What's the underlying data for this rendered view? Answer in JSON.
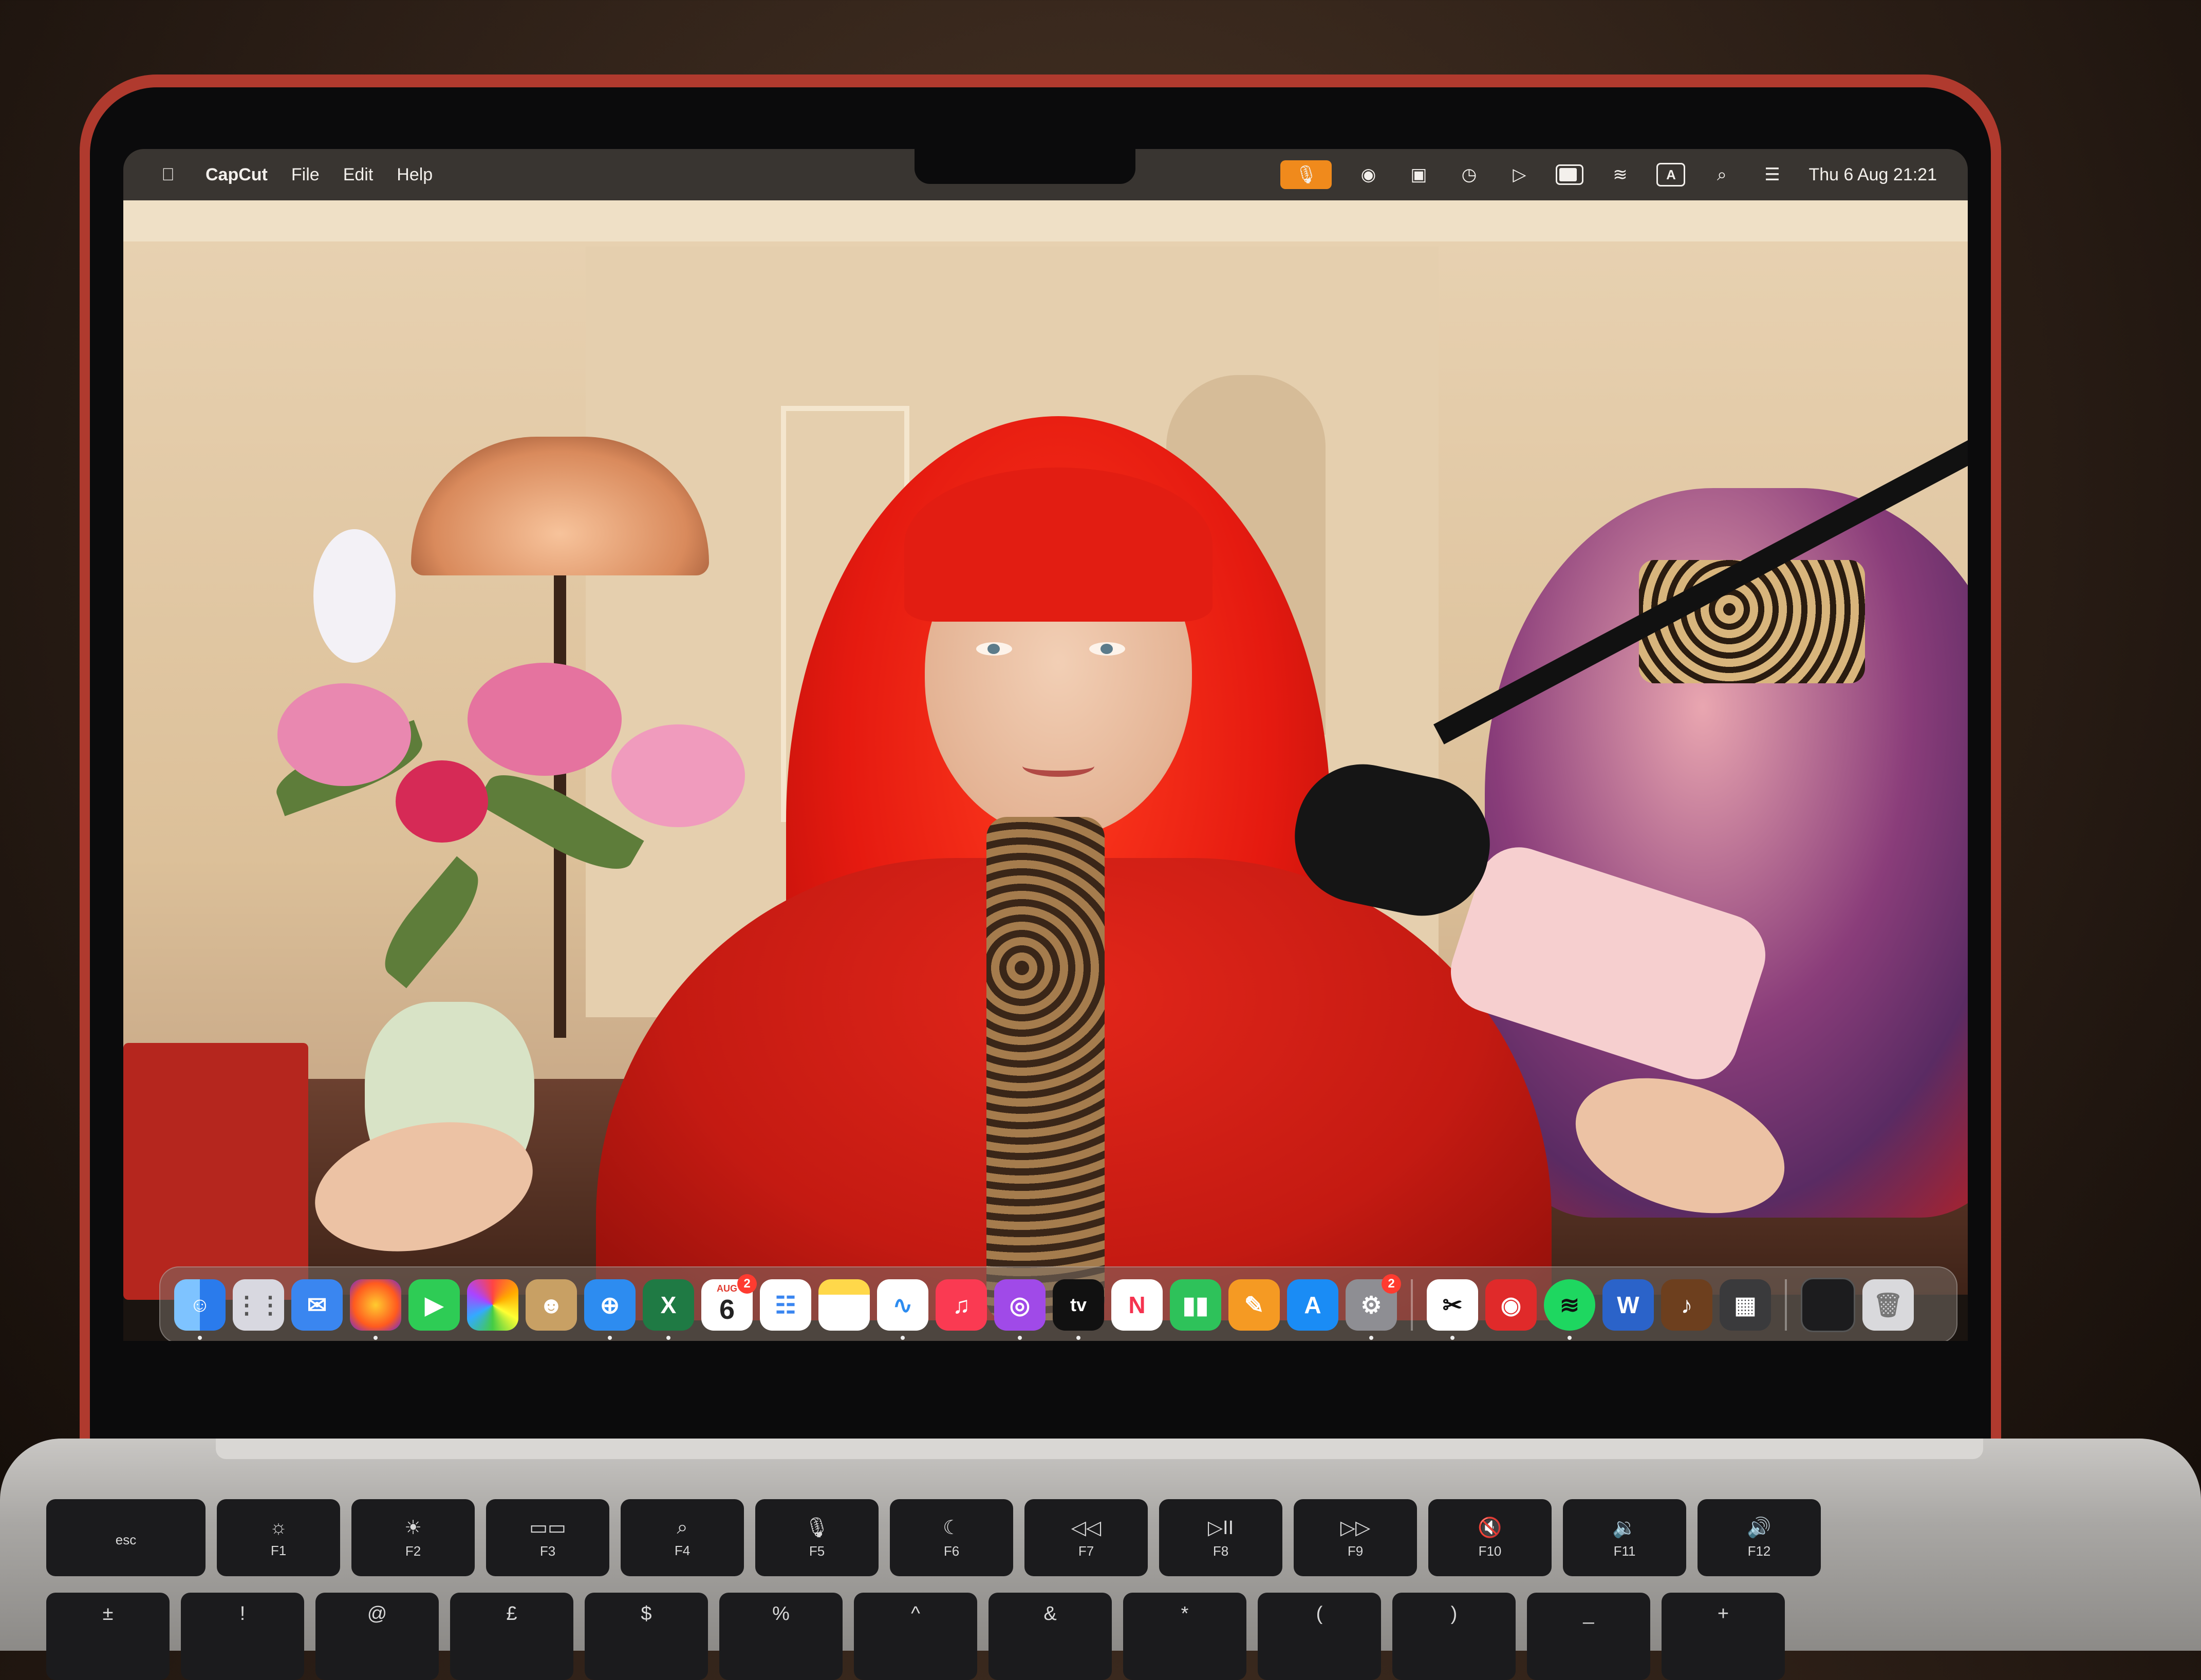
{
  "menubar": {
    "app_name": "CapCut",
    "menus": [
      "File",
      "Edit",
      "Help"
    ],
    "status": {
      "icons": [
        "mic-icon",
        "screen-record-icon",
        "camera-icon",
        "time-machine-icon",
        "play-icon",
        "battery-icon",
        "wifi-icon",
        "keyboard-input-icon",
        "search-icon",
        "control-center-icon"
      ],
      "input_source": "A",
      "clock": "Thu 6 Aug  21:21"
    },
    "colors": {
      "mic_active": "#f08a1c"
    }
  },
  "dock": {
    "apps": [
      {
        "name": "Finder",
        "icon": "finder-icon",
        "color": "#3b8ff0"
      },
      {
        "name": "Launchpad",
        "icon": "launchpad-icon",
        "color": "#d8d8e0"
      },
      {
        "name": "Mail",
        "icon": "mail-icon",
        "color": "#3a86f0"
      },
      {
        "name": "Firefox",
        "icon": "firefox-icon",
        "color": "#ff7b1c"
      },
      {
        "name": "FaceTime",
        "icon": "facetime-icon",
        "color": "#2ecc55"
      },
      {
        "name": "Photos",
        "icon": "photos-icon",
        "color": "#f4f0ec"
      },
      {
        "name": "Contacts",
        "icon": "contacts-icon",
        "color": "#c8a064"
      },
      {
        "name": "Safari",
        "icon": "safari-icon",
        "color": "#2d8cf0"
      },
      {
        "name": "Excel",
        "icon": "excel-icon",
        "color": "#1f7a44"
      },
      {
        "name": "Calendar",
        "icon": "calendar-icon",
        "color": "#ffffff",
        "month": "AUG",
        "day": "6",
        "badge": "2"
      },
      {
        "name": "Reminders",
        "icon": "reminders-icon",
        "color": "#ffffff"
      },
      {
        "name": "Notes",
        "icon": "notes-icon",
        "color": "#ffd84a"
      },
      {
        "name": "Freeform",
        "icon": "freeform-icon",
        "color": "#ffffff"
      },
      {
        "name": "Music",
        "icon": "music-icon",
        "color": "#fa3a52"
      },
      {
        "name": "Podcasts",
        "icon": "podcasts-icon",
        "color": "#a04ae8"
      },
      {
        "name": "TV",
        "icon": "appletv-icon",
        "color": "#111111",
        "label": "tv"
      },
      {
        "name": "News",
        "icon": "news-icon",
        "color": "#ffffff"
      },
      {
        "name": "Numbers",
        "icon": "numbers-icon",
        "color": "#2ec25a"
      },
      {
        "name": "Pages",
        "icon": "pages-icon",
        "color": "#f59a23"
      },
      {
        "name": "App Store",
        "icon": "app-store-icon",
        "color": "#1a8cf5"
      },
      {
        "name": "System Settings",
        "icon": "settings-icon",
        "color": "#8e8e93",
        "badge": "2"
      }
    ],
    "apps_right": [
      {
        "name": "CapCut",
        "icon": "capcut-icon",
        "color": "#ffffff"
      },
      {
        "name": "Recorder",
        "icon": "screen-recorder-icon",
        "color": "#e02a2a"
      },
      {
        "name": "Spotify",
        "icon": "spotify-icon",
        "color": "#1ed760"
      },
      {
        "name": "Word",
        "icon": "word-icon",
        "color": "#2b63c9"
      },
      {
        "name": "GarageBand",
        "icon": "garageband-icon",
        "color": "#6d3f1e"
      },
      {
        "name": "Calculator",
        "icon": "calculator-icon",
        "color": "#3a3a3c"
      }
    ],
    "utility": [
      {
        "name": "Terminal",
        "icon": "terminal-icon",
        "color": "#1c1c1e"
      },
      {
        "name": "Trash",
        "icon": "trash-icon",
        "color": "#d9d9dc"
      }
    ]
  },
  "keyboard": {
    "function_row": [
      {
        "label": "esc",
        "glyph": ""
      },
      {
        "label": "F1",
        "glyph": "☼"
      },
      {
        "label": "F2",
        "glyph": "☀"
      },
      {
        "label": "F3",
        "glyph": "▭▭"
      },
      {
        "label": "F4",
        "glyph": "⌕"
      },
      {
        "label": "F5",
        "glyph": "🎙"
      },
      {
        "label": "F6",
        "glyph": "☾"
      },
      {
        "label": "F7",
        "glyph": "◁◁"
      },
      {
        "label": "F8",
        "glyph": "▷II"
      },
      {
        "label": "F9",
        "glyph": "▷▷"
      },
      {
        "label": "F10",
        "glyph": "🔇"
      },
      {
        "label": "F11",
        "glyph": "🔉"
      },
      {
        "label": "F12",
        "glyph": "🔊"
      }
    ],
    "number_row": [
      "±",
      "!",
      "@",
      "£",
      "$",
      "%",
      "^",
      "&",
      "*",
      "(",
      ")",
      "_",
      "+"
    ]
  }
}
